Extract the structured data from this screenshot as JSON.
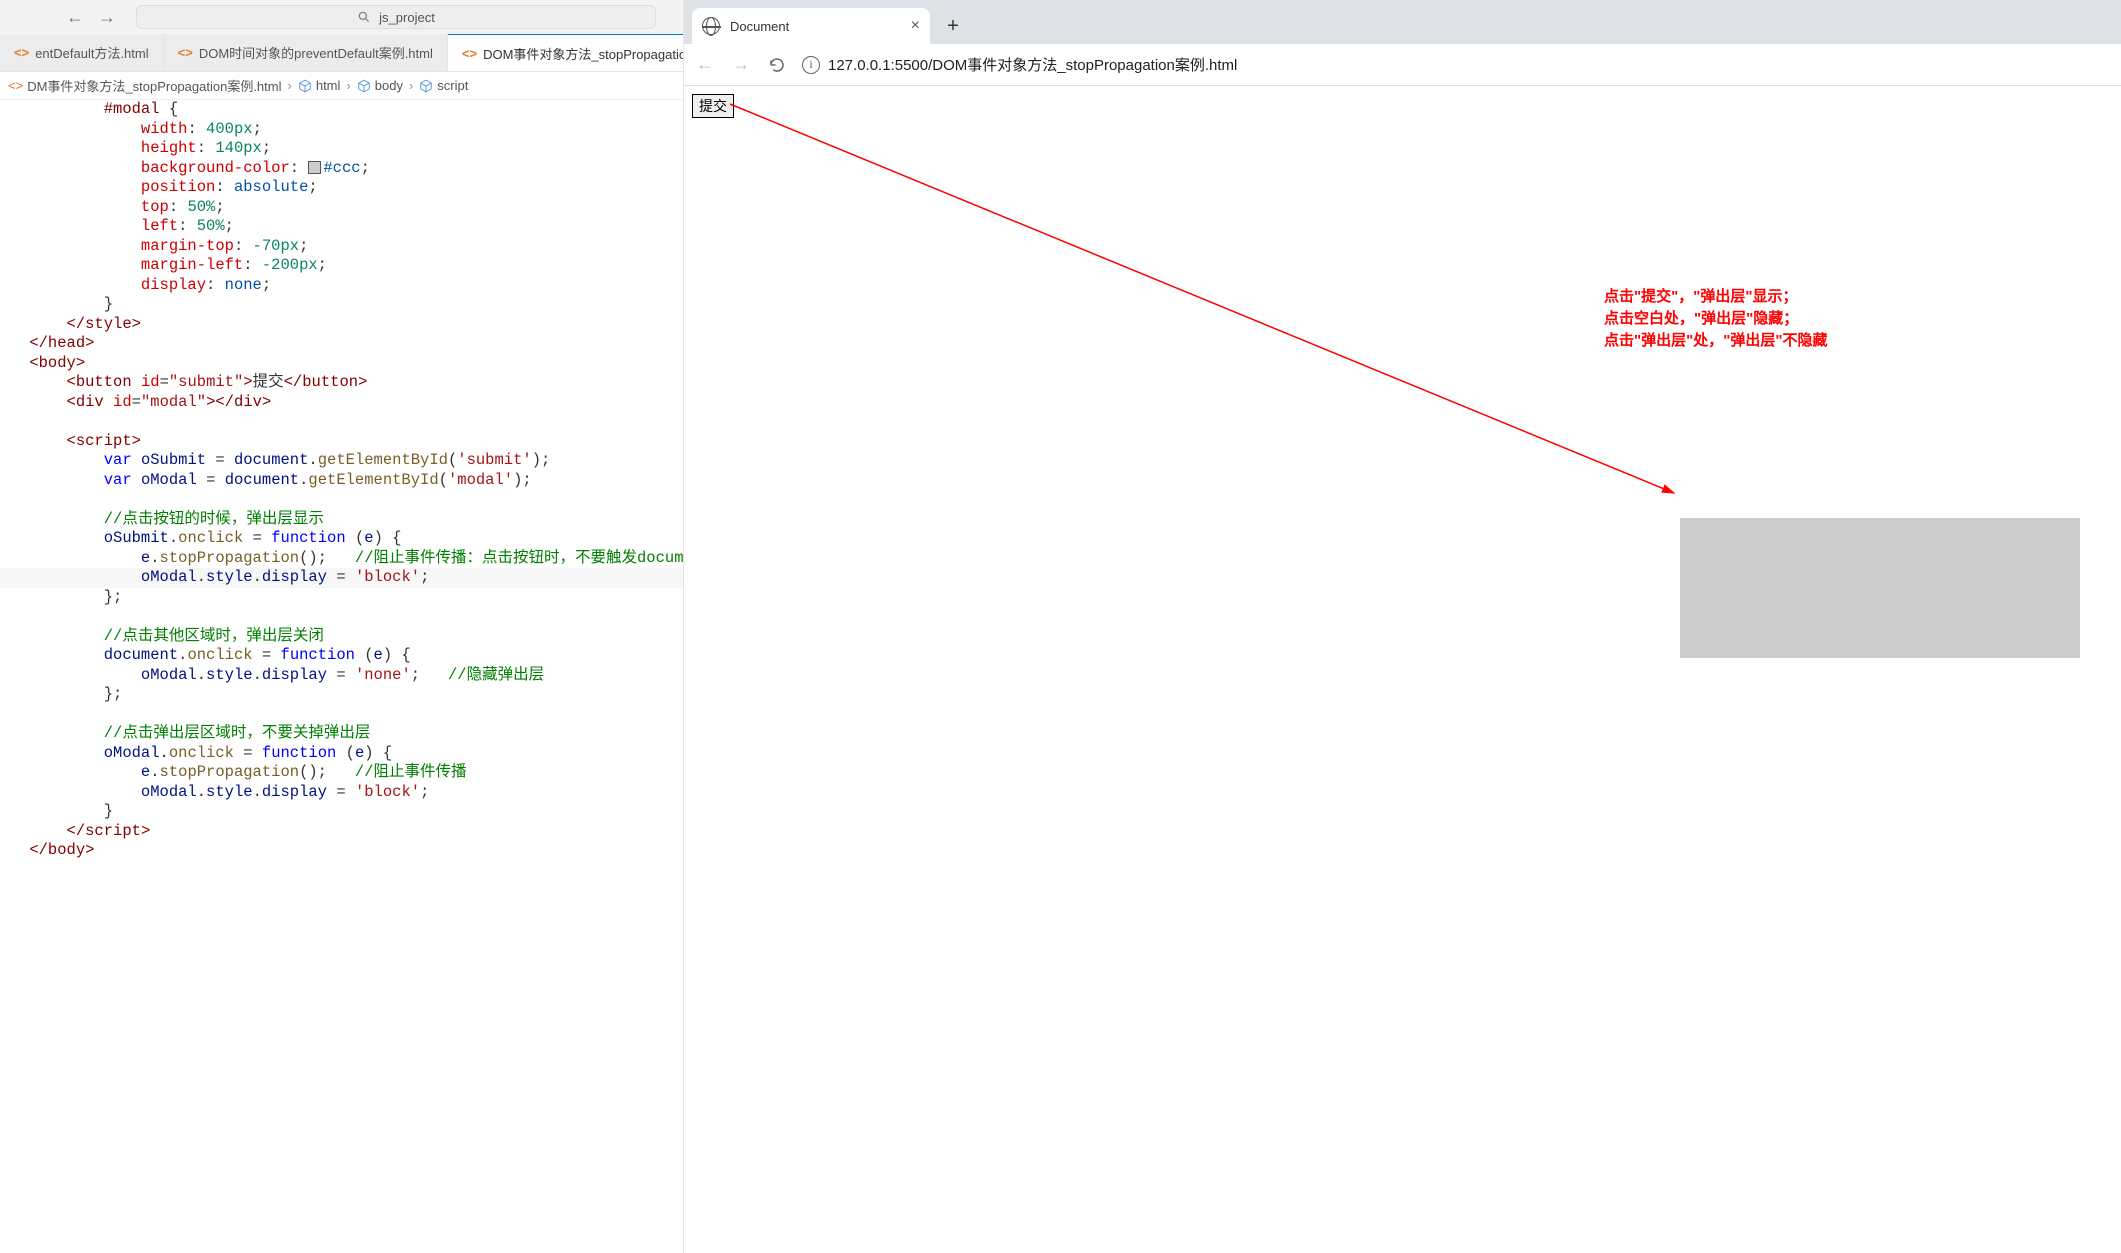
{
  "editor": {
    "command_center": "js_project",
    "tabs": [
      {
        "name": "entDefault方法.html",
        "active": false
      },
      {
        "name": "DOM时间对象的preventDefault案例.html",
        "active": false
      },
      {
        "name": "DOM事件对象方法_stopPropagation",
        "active": true
      }
    ],
    "breadcrumbs": {
      "file": "DM事件对象方法_stopPropagation案例.html",
      "parts": [
        "html",
        "body",
        "script"
      ]
    },
    "code": [
      {
        "t": [
          [
            "         ",
            ""
          ],
          [
            "#modal",
            1
          ],
          [
            " {",
            0
          ]
        ]
      },
      {
        "t": [
          [
            "             ",
            ""
          ],
          [
            "width",
            2
          ],
          [
            ": ",
            0
          ],
          [
            "400px",
            3
          ],
          [
            ";",
            0
          ]
        ]
      },
      {
        "t": [
          [
            "             ",
            ""
          ],
          [
            "height",
            2
          ],
          [
            ": ",
            0
          ],
          [
            "140px",
            3
          ],
          [
            ";",
            0
          ]
        ]
      },
      {
        "t": [
          [
            "             ",
            ""
          ],
          [
            "background-color",
            2
          ],
          [
            ": ",
            0
          ],
          [
            "SW",
            99
          ],
          [
            "#ccc",
            4
          ],
          [
            ";",
            0
          ]
        ]
      },
      {
        "t": [
          [
            "             ",
            ""
          ],
          [
            "position",
            2
          ],
          [
            ": ",
            0
          ],
          [
            "absolute",
            4
          ],
          [
            ";",
            0
          ]
        ]
      },
      {
        "t": [
          [
            "             ",
            ""
          ],
          [
            "top",
            2
          ],
          [
            ": ",
            0
          ],
          [
            "50%",
            3
          ],
          [
            ";",
            0
          ]
        ]
      },
      {
        "t": [
          [
            "             ",
            ""
          ],
          [
            "left",
            2
          ],
          [
            ": ",
            0
          ],
          [
            "50%",
            3
          ],
          [
            ";",
            0
          ]
        ]
      },
      {
        "t": [
          [
            "             ",
            ""
          ],
          [
            "margin-top",
            2
          ],
          [
            ": ",
            0
          ],
          [
            "-70px",
            3
          ],
          [
            ";",
            0
          ]
        ]
      },
      {
        "t": [
          [
            "             ",
            ""
          ],
          [
            "margin-left",
            2
          ],
          [
            ": ",
            0
          ],
          [
            "-200px",
            3
          ],
          [
            ";",
            0
          ]
        ]
      },
      {
        "t": [
          [
            "             ",
            ""
          ],
          [
            "display",
            2
          ],
          [
            ": ",
            0
          ],
          [
            "none",
            4
          ],
          [
            ";",
            0
          ]
        ]
      },
      {
        "t": [
          [
            "         ",
            ""
          ],
          [
            "}",
            0
          ]
        ]
      },
      {
        "t": [
          [
            "     ",
            ""
          ],
          [
            "</",
            5
          ],
          [
            "style",
            5
          ],
          [
            ">",
            5
          ]
        ]
      },
      {
        "t": [
          [
            " ",
            ""
          ],
          [
            "</",
            5
          ],
          [
            "head",
            5
          ],
          [
            ">",
            5
          ]
        ]
      },
      {
        "t": [
          [
            " ",
            ""
          ],
          [
            "<",
            5
          ],
          [
            "body",
            5
          ],
          [
            ">",
            5
          ]
        ]
      },
      {
        "t": [
          [
            "     ",
            ""
          ],
          [
            "<",
            5
          ],
          [
            "button",
            5
          ],
          [
            " ",
            0
          ],
          [
            "id",
            6
          ],
          [
            "=",
            0
          ],
          [
            "\"submit\"",
            7
          ],
          [
            ">",
            5
          ],
          [
            "提交",
            0
          ],
          [
            "</",
            5
          ],
          [
            "button",
            5
          ],
          [
            ">",
            5
          ]
        ]
      },
      {
        "t": [
          [
            "     ",
            ""
          ],
          [
            "<",
            5
          ],
          [
            "div",
            5
          ],
          [
            " ",
            0
          ],
          [
            "id",
            6
          ],
          [
            "=",
            0
          ],
          [
            "\"modal\"",
            7
          ],
          [
            ">",
            5
          ],
          [
            "</",
            5
          ],
          [
            "div",
            5
          ],
          [
            ">",
            5
          ]
        ]
      },
      {
        "t": [
          [
            " ",
            ""
          ]
        ]
      },
      {
        "t": [
          [
            "     ",
            ""
          ],
          [
            "<",
            5
          ],
          [
            "script",
            5
          ],
          [
            ">",
            5
          ]
        ]
      },
      {
        "t": [
          [
            "         ",
            ""
          ],
          [
            "var",
            8
          ],
          [
            " ",
            0
          ],
          [
            "oSubmit",
            9
          ],
          [
            " ",
            0
          ],
          [
            "=",
            0
          ],
          [
            " ",
            0
          ],
          [
            "document",
            9
          ],
          [
            ".",
            0
          ],
          [
            "getElementById",
            10
          ],
          [
            "(",
            0
          ],
          [
            "'submit'",
            7
          ],
          [
            ");",
            0
          ]
        ]
      },
      {
        "t": [
          [
            "         ",
            ""
          ],
          [
            "var",
            8
          ],
          [
            " ",
            0
          ],
          [
            "oModal",
            9
          ],
          [
            " ",
            0
          ],
          [
            "=",
            0
          ],
          [
            " ",
            0
          ],
          [
            "document",
            9
          ],
          [
            ".",
            0
          ],
          [
            "getElementById",
            10
          ],
          [
            "(",
            0
          ],
          [
            "'modal'",
            7
          ],
          [
            ");",
            0
          ]
        ]
      },
      {
        "t": [
          [
            " ",
            ""
          ]
        ]
      },
      {
        "t": [
          [
            "         ",
            ""
          ],
          [
            "//点击按钮的时候，弹出层显示",
            11
          ]
        ]
      },
      {
        "t": [
          [
            "         ",
            ""
          ],
          [
            "oSubmit",
            9
          ],
          [
            ".",
            0
          ],
          [
            "onclick",
            10
          ],
          [
            " ",
            0
          ],
          [
            "=",
            0
          ],
          [
            " ",
            0
          ],
          [
            "function",
            8
          ],
          [
            " (",
            0
          ],
          [
            "e",
            9
          ],
          [
            ") {",
            0
          ]
        ]
      },
      {
        "t": [
          [
            "             ",
            ""
          ],
          [
            "e",
            9
          ],
          [
            ".",
            0
          ],
          [
            "stopPropagation",
            10
          ],
          [
            "();",
            0
          ],
          [
            "   ",
            0
          ],
          [
            "//阻止事件传播：点击按钮时，不要触发document.onclick事件",
            11
          ]
        ]
      },
      {
        "t": [
          [
            "             ",
            ""
          ],
          [
            "oModal",
            9
          ],
          [
            ".",
            0
          ],
          [
            "style",
            9
          ],
          [
            ".",
            0
          ],
          [
            "display",
            9
          ],
          [
            " ",
            0
          ],
          [
            "=",
            0
          ],
          [
            " ",
            0
          ],
          [
            "'block'",
            7
          ],
          [
            ";",
            0
          ]
        ],
        "hl": true
      },
      {
        "t": [
          [
            "         ",
            ""
          ],
          [
            "};",
            0
          ]
        ]
      },
      {
        "t": [
          [
            " ",
            ""
          ]
        ]
      },
      {
        "t": [
          [
            "         ",
            ""
          ],
          [
            "//点击其他区域时，弹出层关闭",
            11
          ]
        ]
      },
      {
        "t": [
          [
            "         ",
            ""
          ],
          [
            "document",
            9
          ],
          [
            ".",
            0
          ],
          [
            "onclick",
            10
          ],
          [
            " ",
            0
          ],
          [
            "=",
            0
          ],
          [
            " ",
            0
          ],
          [
            "function",
            8
          ],
          [
            " (",
            0
          ],
          [
            "e",
            9
          ],
          [
            ") {",
            0
          ]
        ]
      },
      {
        "t": [
          [
            "             ",
            ""
          ],
          [
            "oModal",
            9
          ],
          [
            ".",
            0
          ],
          [
            "style",
            9
          ],
          [
            ".",
            0
          ],
          [
            "display",
            9
          ],
          [
            " ",
            0
          ],
          [
            "=",
            0
          ],
          [
            " ",
            0
          ],
          [
            "'none'",
            7
          ],
          [
            ";",
            0
          ],
          [
            "   ",
            0
          ],
          [
            "//隐藏弹出层",
            11
          ]
        ]
      },
      {
        "t": [
          [
            "         ",
            ""
          ],
          [
            "};",
            0
          ]
        ]
      },
      {
        "t": [
          [
            " ",
            ""
          ]
        ]
      },
      {
        "t": [
          [
            "         ",
            ""
          ],
          [
            "//点击弹出层区域时，不要关掉弹出层",
            11
          ]
        ]
      },
      {
        "t": [
          [
            "         ",
            ""
          ],
          [
            "oModal",
            9
          ],
          [
            ".",
            0
          ],
          [
            "onclick",
            10
          ],
          [
            " ",
            0
          ],
          [
            "=",
            0
          ],
          [
            " ",
            0
          ],
          [
            "function",
            8
          ],
          [
            " (",
            0
          ],
          [
            "e",
            9
          ],
          [
            ") {",
            0
          ]
        ]
      },
      {
        "t": [
          [
            "             ",
            ""
          ],
          [
            "e",
            9
          ],
          [
            ".",
            0
          ],
          [
            "stopPropagation",
            10
          ],
          [
            "();",
            0
          ],
          [
            "   ",
            0
          ],
          [
            "//阻止事件传播",
            11
          ]
        ]
      },
      {
        "t": [
          [
            "             ",
            ""
          ],
          [
            "oModal",
            9
          ],
          [
            ".",
            0
          ],
          [
            "style",
            9
          ],
          [
            ".",
            0
          ],
          [
            "display",
            9
          ],
          [
            " ",
            0
          ],
          [
            "=",
            0
          ],
          [
            " ",
            0
          ],
          [
            "'block'",
            7
          ],
          [
            ";",
            0
          ]
        ]
      },
      {
        "t": [
          [
            "         ",
            ""
          ],
          [
            "}",
            0
          ]
        ]
      },
      {
        "t": [
          [
            "     ",
            ""
          ],
          [
            "</",
            5
          ],
          [
            "script",
            5
          ],
          [
            ">",
            5
          ]
        ]
      },
      {
        "t": [
          [
            " ",
            ""
          ],
          [
            "</",
            5
          ],
          [
            "body",
            5
          ],
          [
            ">",
            5
          ]
        ]
      }
    ]
  },
  "browser": {
    "tab_title": "Document",
    "url": "127.0.0.1:5500/DOM事件对象方法_stopPropagation案例.html",
    "submit_btn": "提交",
    "annotations": [
      "点击\"提交\"，\"弹出层\"显示；",
      "点击空白处，\"弹出层\"隐藏；",
      "点击\"弹出层\"处，\"弹出层\"不隐藏"
    ]
  }
}
